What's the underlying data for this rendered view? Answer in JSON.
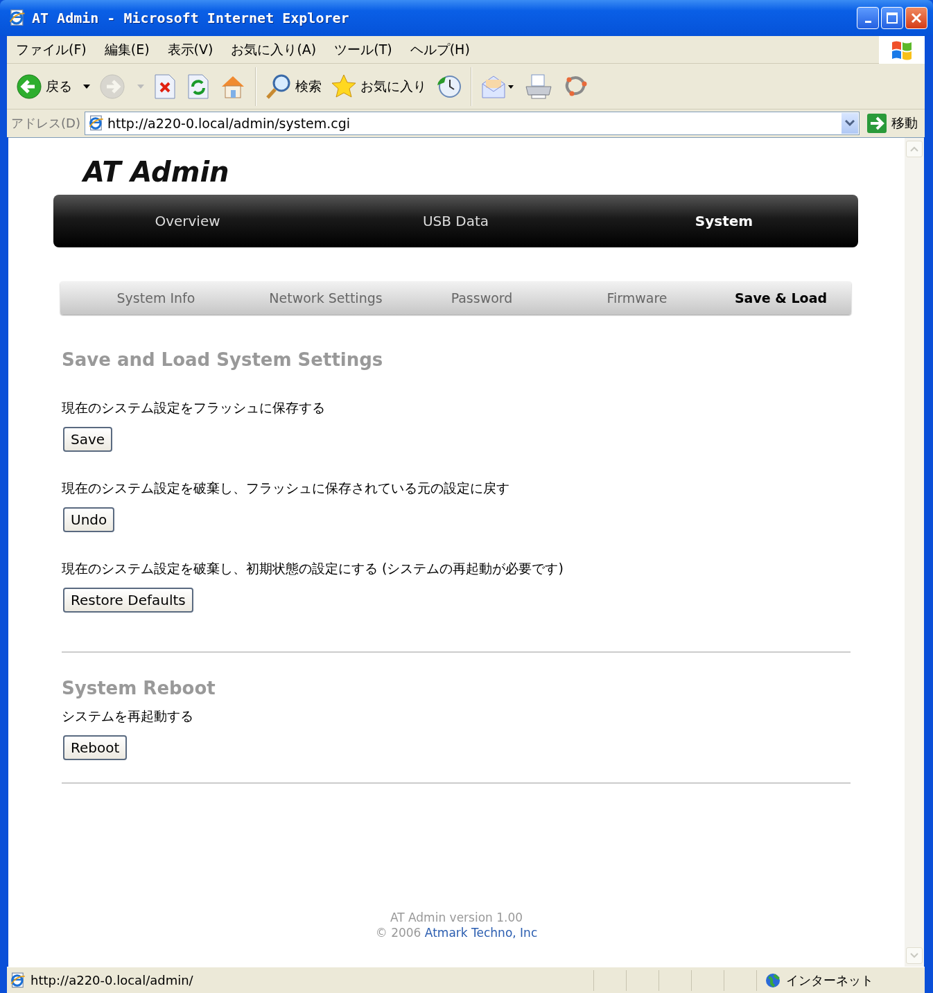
{
  "window": {
    "title": "AT Admin - Microsoft Internet Explorer"
  },
  "menu": [
    "ファイル(F)",
    "編集(E)",
    "表示(V)",
    "お気に入り(A)",
    "ツール(T)",
    "ヘルプ(H)"
  ],
  "toolbar": {
    "buttons": [
      {
        "kind": "back",
        "label": "戻る",
        "disabled": false
      },
      {
        "kind": "forward",
        "disabled": true
      },
      {
        "kind": "stop",
        "disabled": false
      },
      {
        "kind": "refresh",
        "disabled": false
      },
      {
        "kind": "home",
        "disabled": false
      },
      {
        "kind": "search",
        "label": "検索",
        "disabled": false
      },
      {
        "kind": "favorites",
        "label": "お気に入り",
        "disabled": false
      },
      {
        "kind": "history",
        "disabled": false
      },
      {
        "kind": "mail",
        "disabled": false
      },
      {
        "kind": "print",
        "disabled": false
      },
      {
        "kind": "messenger",
        "disabled": false
      }
    ]
  },
  "address": {
    "label": "アドレス(D)",
    "value": "http://a220-0.local/admin/system.cgi",
    "go": "移動"
  },
  "page": {
    "logo": "AT Admin",
    "nav": [
      {
        "label": "Overview",
        "selected": false
      },
      {
        "label": "USB Data",
        "selected": false
      },
      {
        "label": "System",
        "selected": true
      }
    ],
    "subnav": [
      {
        "label": "System Info",
        "selected": false
      },
      {
        "label": "Network Settings",
        "selected": false
      },
      {
        "label": "Password",
        "selected": false
      },
      {
        "label": "Firmware",
        "selected": false
      },
      {
        "label": "Save & Load",
        "selected": true
      }
    ],
    "sections": [
      {
        "title": "Save and Load System Settings",
        "actions": [
          {
            "description": "現在のシステム設定をフラッシュに保存する",
            "button": "Save"
          },
          {
            "description": "現在のシステム設定を破棄し、フラッシュに保存されている元の設定に戻す",
            "button": "Undo"
          },
          {
            "description": "現在のシステム設定を破棄し、初期状態の設定にする (システムの再起動が必要です)",
            "button": "Restore Defaults"
          }
        ]
      },
      {
        "title": "System Reboot",
        "actions": [
          {
            "description": "システムを再起動する",
            "button": "Reboot"
          }
        ]
      }
    ],
    "footer": {
      "version": "AT Admin version 1.00",
      "copyright": "© 2006",
      "link": "Atmark Techno, Inc"
    }
  },
  "status_bar": {
    "url": "http://a220-0.local/admin/",
    "zone": "インターネット"
  }
}
